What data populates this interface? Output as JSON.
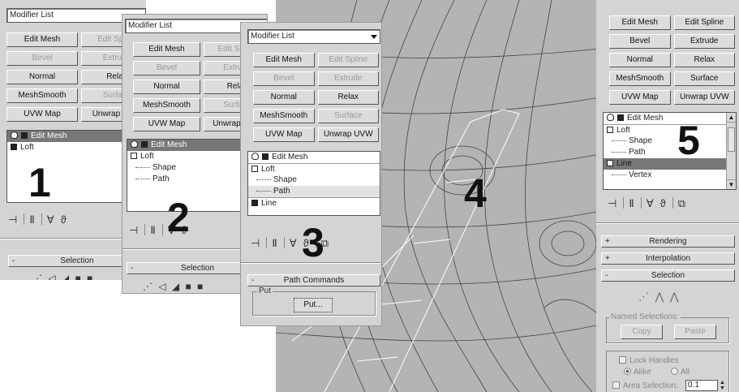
{
  "panel1": {
    "modifier_list": "Modifier List",
    "buttons": [
      "Edit Mesh",
      "Edit Spline",
      "Bevel",
      "Extrude",
      "Normal",
      "Relax",
      "MeshSmooth",
      "Surface",
      "UVW Map",
      "Unwrap UVW"
    ],
    "stack": [
      "Edit Mesh",
      "Loft"
    ],
    "label": "1",
    "rollout": "Selection"
  },
  "panel2": {
    "modifier_list": "Modifier List",
    "buttons": [
      "Edit Mesh",
      "Edit Spline",
      "Bevel",
      "Extrude",
      "Normal",
      "Relax",
      "MeshSmooth",
      "Surface",
      "UVW Map",
      "Unwrap UVW"
    ],
    "stack": [
      "Edit Mesh",
      "Loft",
      "Shape",
      "Path"
    ],
    "label": "2",
    "rollout": "Selection"
  },
  "panel3": {
    "modifier_list": "Modifier List",
    "buttons": [
      "Edit Mesh",
      "Edit Spline",
      "Bevel",
      "Extrude",
      "Normal",
      "Relax",
      "MeshSmooth",
      "Surface",
      "UVW Map",
      "Unwrap UVW"
    ],
    "stack": [
      "Edit Mesh",
      "Loft",
      "Shape",
      "Path",
      "Line"
    ],
    "label": "3",
    "rollout": "Path Commands",
    "group_title": "Put",
    "put_button": "Put..."
  },
  "viewport": {
    "label": "4"
  },
  "panel5": {
    "buttons": [
      "Edit Mesh",
      "Edit Spline",
      "Bevel",
      "Extrude",
      "Normal",
      "Relax",
      "MeshSmooth",
      "Surface",
      "UVW Map",
      "Unwrap UVW"
    ],
    "stack": [
      "Edit Mesh",
      "Loft",
      "Shape",
      "Path",
      "Line",
      "Vertex"
    ],
    "label": "5",
    "rollouts": [
      "Rendering",
      "Interpolation",
      "Selection"
    ],
    "named_selections": "Named Selections:",
    "copy": "Copy",
    "paste": "Paste",
    "lock_handles": "Lock Handles",
    "alike": "Alike",
    "all": "All",
    "area_selection": "Area Selection:",
    "area_value": "0.1"
  }
}
